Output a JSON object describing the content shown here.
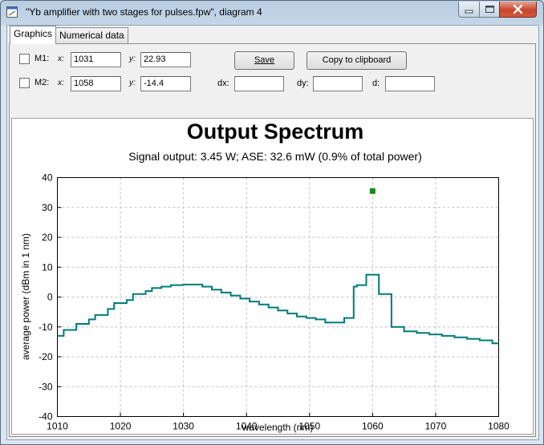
{
  "window": {
    "title": "\"Yb amplifier with two stages for pulses.fpw\", diagram 4"
  },
  "tabs": [
    {
      "label": "Graphics",
      "active": true
    },
    {
      "label": "Numerical data",
      "active": false
    }
  ],
  "markers": {
    "m1": {
      "label": "M1:",
      "checked": false,
      "x_label": "x:",
      "x_value": "1031",
      "y_label": "y:",
      "y_value": "22.93"
    },
    "m2": {
      "label": "M2:",
      "checked": false,
      "x_label": "x:",
      "x_value": "1058",
      "y_label": "y:",
      "y_value": "-14.4"
    },
    "dx_label": "dx:",
    "dx_value": "",
    "dy_label": "dy:",
    "dy_value": "",
    "d_label": "d:",
    "d_value": ""
  },
  "buttons": {
    "save": "Save",
    "copy": "Copy to clipboard"
  },
  "colors": {
    "line": "#007a7a",
    "marker": "#1a8a1a",
    "grid": "#bfbfbf"
  },
  "chart_data": {
    "type": "line",
    "title": "Output Spectrum",
    "subtitle": "Signal output: 3.45 W; ASE: 32.6 mW (0.9% of total power)",
    "xlabel": "wavelength (nm)",
    "ylabel": "average power (dBm in 1 nm)",
    "xlim": [
      1010,
      1080
    ],
    "ylim": [
      -40,
      40
    ],
    "xticks": [
      1010,
      1020,
      1030,
      1040,
      1050,
      1060,
      1070,
      1080
    ],
    "yticks": [
      -40,
      -30,
      -20,
      -10,
      0,
      10,
      20,
      30,
      40
    ],
    "grid": true,
    "series": [
      {
        "x": [
          1010,
          1011,
          1011,
          1013,
          1013,
          1015,
          1015,
          1016,
          1016,
          1018,
          1018,
          1019,
          1019,
          1021,
          1021,
          1022,
          1022,
          1024,
          1024,
          1025,
          1025,
          1026.5,
          1026.5,
          1028,
          1028,
          1030,
          1030,
          1033,
          1033,
          1034.5,
          1034.5,
          1036,
          1036,
          1037.5,
          1037.5,
          1039,
          1039,
          1040.5,
          1040.5,
          1042,
          1042,
          1043.5,
          1043.5,
          1045,
          1045,
          1046.5,
          1046.5,
          1048,
          1048,
          1049.5,
          1049.5,
          1051,
          1051,
          1052.5,
          1052.5,
          1054,
          1054,
          1055.5,
          1055.5,
          1057,
          1057,
          1057.5,
          1057.5,
          1059,
          1059,
          1060,
          1060,
          1061,
          1061,
          1063,
          1063,
          1065,
          1065,
          1067,
          1067,
          1069,
          1069,
          1071,
          1071,
          1073,
          1073,
          1075,
          1075,
          1077,
          1077,
          1079,
          1079,
          1080
        ],
        "y": [
          -13,
          -13,
          -11,
          -11,
          -9,
          -9,
          -7.5,
          -7.5,
          -6,
          -6,
          -4,
          -4,
          -2,
          -2,
          -1,
          -1,
          1,
          1,
          2,
          2,
          3,
          3,
          3.5,
          3.5,
          4,
          4,
          4.2,
          4.2,
          3.5,
          3.5,
          2.5,
          2.5,
          1.5,
          1.5,
          0.5,
          0.5,
          -0.5,
          -0.5,
          -1.5,
          -1.5,
          -2.5,
          -2.5,
          -3.5,
          -3.5,
          -4.5,
          -4.5,
          -5.5,
          -5.5,
          -6.5,
          -6.5,
          -7,
          -7,
          -7.5,
          -7.5,
          -8.5,
          -8.5,
          -8.5,
          -8.5,
          -7,
          -7,
          3.5,
          3.5,
          4,
          4,
          7.5,
          7.5,
          7.5,
          7.5,
          1,
          1,
          -10,
          -10,
          -11.5,
          -11.5,
          -12,
          -12,
          -12.5,
          -12.5,
          -13,
          -13,
          -13.5,
          -13.5,
          -14,
          -14,
          -14.5,
          -14.5,
          -15.5,
          -15.5
        ]
      }
    ],
    "markers": [
      {
        "x": 1060,
        "y": 35.5
      }
    ]
  }
}
